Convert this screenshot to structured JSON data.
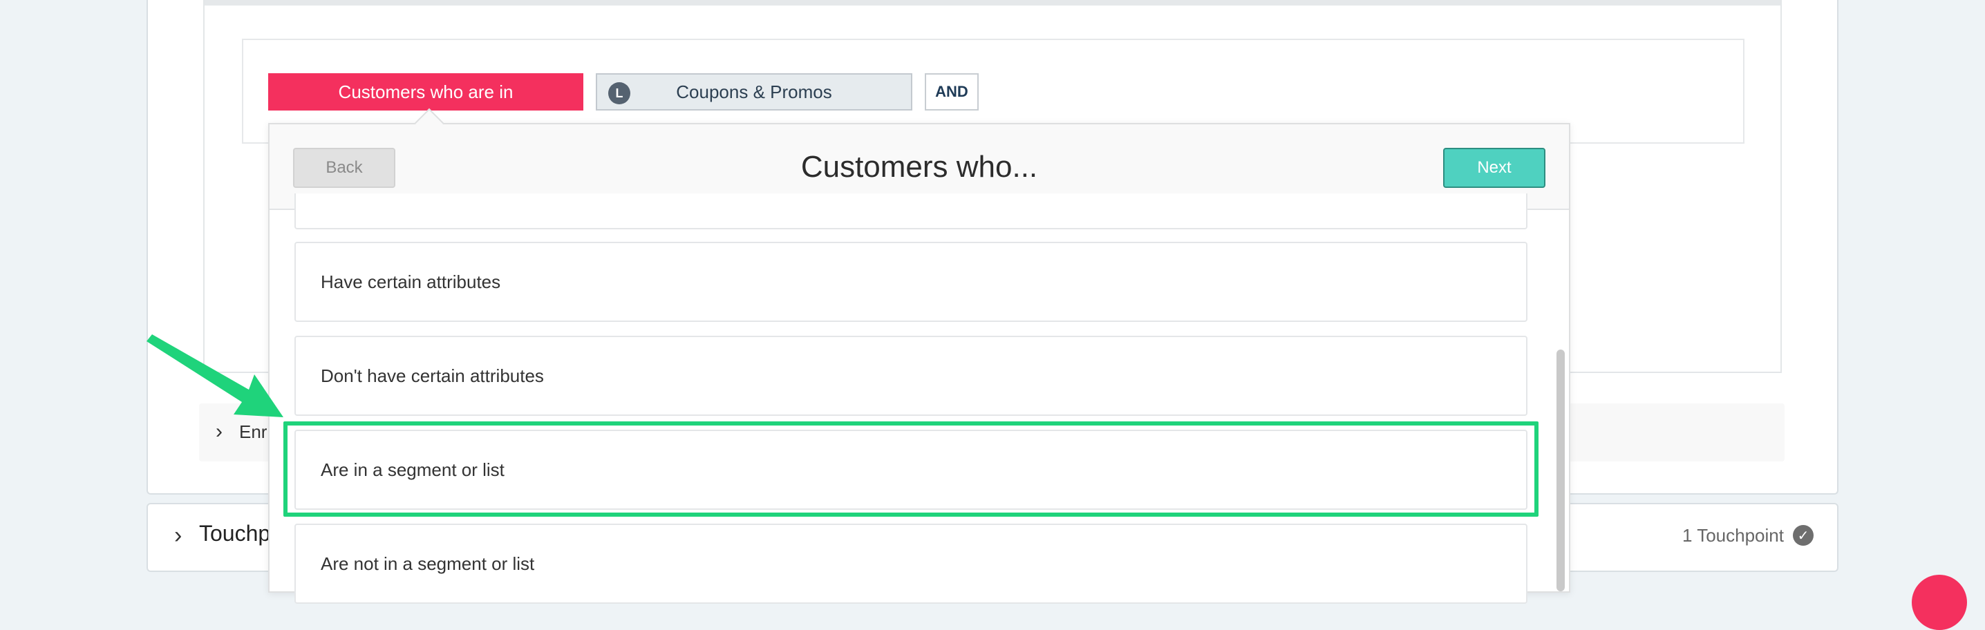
{
  "builder": {
    "audience_chip": "Customers who are in",
    "segment_chip": {
      "badge": "L",
      "label": "Coupons & Promos"
    },
    "and_button": "AND"
  },
  "enrollment": {
    "label": "Enr"
  },
  "touchpoints": {
    "label": "Touchp",
    "count": "1 Touchpoint"
  },
  "modal": {
    "title": "Customers who...",
    "back_label": "Back",
    "next_label": "Next",
    "options": [
      {
        "label": "Have certain attributes"
      },
      {
        "label": "Don't have certain attributes"
      },
      {
        "label": "Are in a segment or list"
      },
      {
        "label": "Are not in a segment or list"
      }
    ]
  },
  "colors": {
    "audience_chip": "#f4305e",
    "next_button": "#4fd1c0",
    "highlight": "#1fd37b",
    "background": "#eef3f6"
  }
}
